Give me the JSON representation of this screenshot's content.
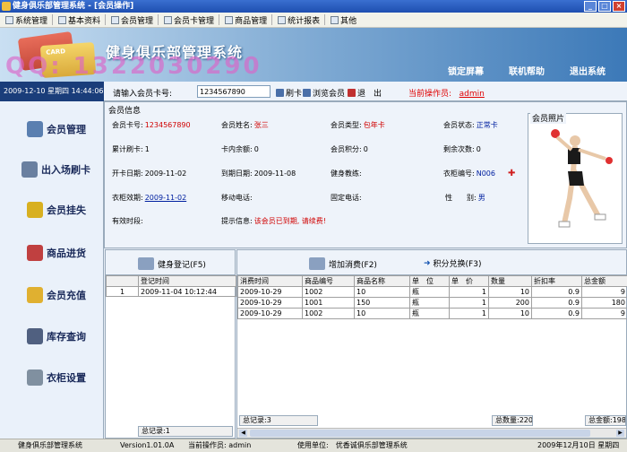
{
  "window": {
    "title": "健身俱乐部管理系统 - [会员操作]"
  },
  "menu": [
    {
      "label": "系统管理",
      "icon": "system-icon"
    },
    {
      "label": "基本资料",
      "icon": "document-icon"
    },
    {
      "label": "会员管理",
      "icon": "member-icon"
    },
    {
      "label": "会员卡管理",
      "icon": "card-icon"
    },
    {
      "label": "商品管理",
      "icon": "goods-icon"
    },
    {
      "label": "统计报表",
      "icon": "report-icon"
    },
    {
      "label": "其他",
      "icon": "other-icon"
    }
  ],
  "banner": {
    "title": "健身俱乐部管理系统",
    "phone": "QQ: 1322030290",
    "lock": "锁定屏幕",
    "help": "联机帮助",
    "exit": "退出系统"
  },
  "datetime": "2009-12-10  星期四 14:44:06",
  "cardbar": {
    "label": "请输入会员卡号:",
    "value": "1234567890",
    "swipe": "刷卡",
    "browse": "浏览会员",
    "back": "退　出",
    "operator_label": "当前操作员:",
    "operator": "admin"
  },
  "sidebar": [
    {
      "label": "会员管理",
      "icon": "member-manage-icon",
      "color": "#5a7fb0"
    },
    {
      "label": "出入场刷卡",
      "icon": "laptop-icon",
      "color": "#6a80a0"
    },
    {
      "label": "会员挂失",
      "icon": "key-icon",
      "color": "#d8b020"
    },
    {
      "label": "商品进货",
      "icon": "goods-in-icon",
      "color": "#c04040"
    },
    {
      "label": "会员充值",
      "icon": "recharge-icon",
      "color": "#e0b030"
    },
    {
      "label": "库存查询",
      "icon": "stock-icon",
      "color": "#506080"
    },
    {
      "label": "衣柜设置",
      "icon": "locker-icon",
      "color": "#8090a0"
    }
  ],
  "info": {
    "header": "会员信息",
    "card_no": {
      "label": "会员卡号:",
      "value": "1234567890"
    },
    "name": {
      "label": "会员姓名:",
      "value": "张三"
    },
    "type": {
      "label": "会员类型:",
      "value": "包年卡"
    },
    "status": {
      "label": "会员状态:",
      "value": "正常卡"
    },
    "swipes": {
      "label": "累计刷卡:",
      "value": "1"
    },
    "balance": {
      "label": "卡内余额:",
      "value": "0"
    },
    "points": {
      "label": "会员积分:",
      "value": "0"
    },
    "remaining": {
      "label": "剩余次数:",
      "value": "0"
    },
    "open_date": {
      "label": "开卡日期:",
      "value": "2009-11-02"
    },
    "expire_date": {
      "label": "到期日期:",
      "value": "2009-11-08"
    },
    "coach": {
      "label": "健身教练:",
      "value": ""
    },
    "locker": {
      "label": "衣柜编号:",
      "value": "N006"
    },
    "locker_expire": {
      "label": "衣柜效期:",
      "value": "2009-11-02"
    },
    "mobile": {
      "label": "移动电话:",
      "value": ""
    },
    "phone": {
      "label": "固定电话:",
      "value": ""
    },
    "gender": {
      "label": "性　　别:",
      "value": "男"
    },
    "valid_period": {
      "label": "有效时段:",
      "value": ""
    },
    "tip": {
      "label": "提示信息:",
      "value": "该会员已到期, 请续费!"
    },
    "photo_label": "会员照片"
  },
  "checkin": {
    "button": "健身登记(F5)",
    "header": "登记时间",
    "rows": [
      {
        "no": "1",
        "time": "2009-11-04 10:12:44"
      }
    ],
    "footer": "总记录:1"
  },
  "consume": {
    "add_button": "增加消费(F2)",
    "redeem_button": "积分兑换(F3)",
    "columns": [
      "消费时间",
      "商品编号",
      "商品名称",
      "单　位",
      "单　价",
      "数量",
      "折扣率",
      "总金额"
    ],
    "rows": [
      [
        "2009-10-29",
        "1002",
        "10",
        "瓶",
        "1",
        "10",
        "0.9",
        "9"
      ],
      [
        "2009-10-29",
        "1001",
        "150",
        "瓶",
        "1",
        "200",
        "0.9",
        "180"
      ],
      [
        "2009-10-29",
        "1002",
        "10",
        "瓶",
        "1",
        "10",
        "0.9",
        "9"
      ]
    ],
    "footer_records": "总记录:3",
    "footer_qty": "总数量:220",
    "footer_amount": "总金额:198"
  },
  "status": {
    "app": "健身俱乐部管理系统",
    "version": "Version1.01.0A",
    "operator": "当前操作员: admin",
    "unit": "使用单位:　优香诚俱乐部管理系统",
    "date": "2009年12月10日 星期四"
  }
}
